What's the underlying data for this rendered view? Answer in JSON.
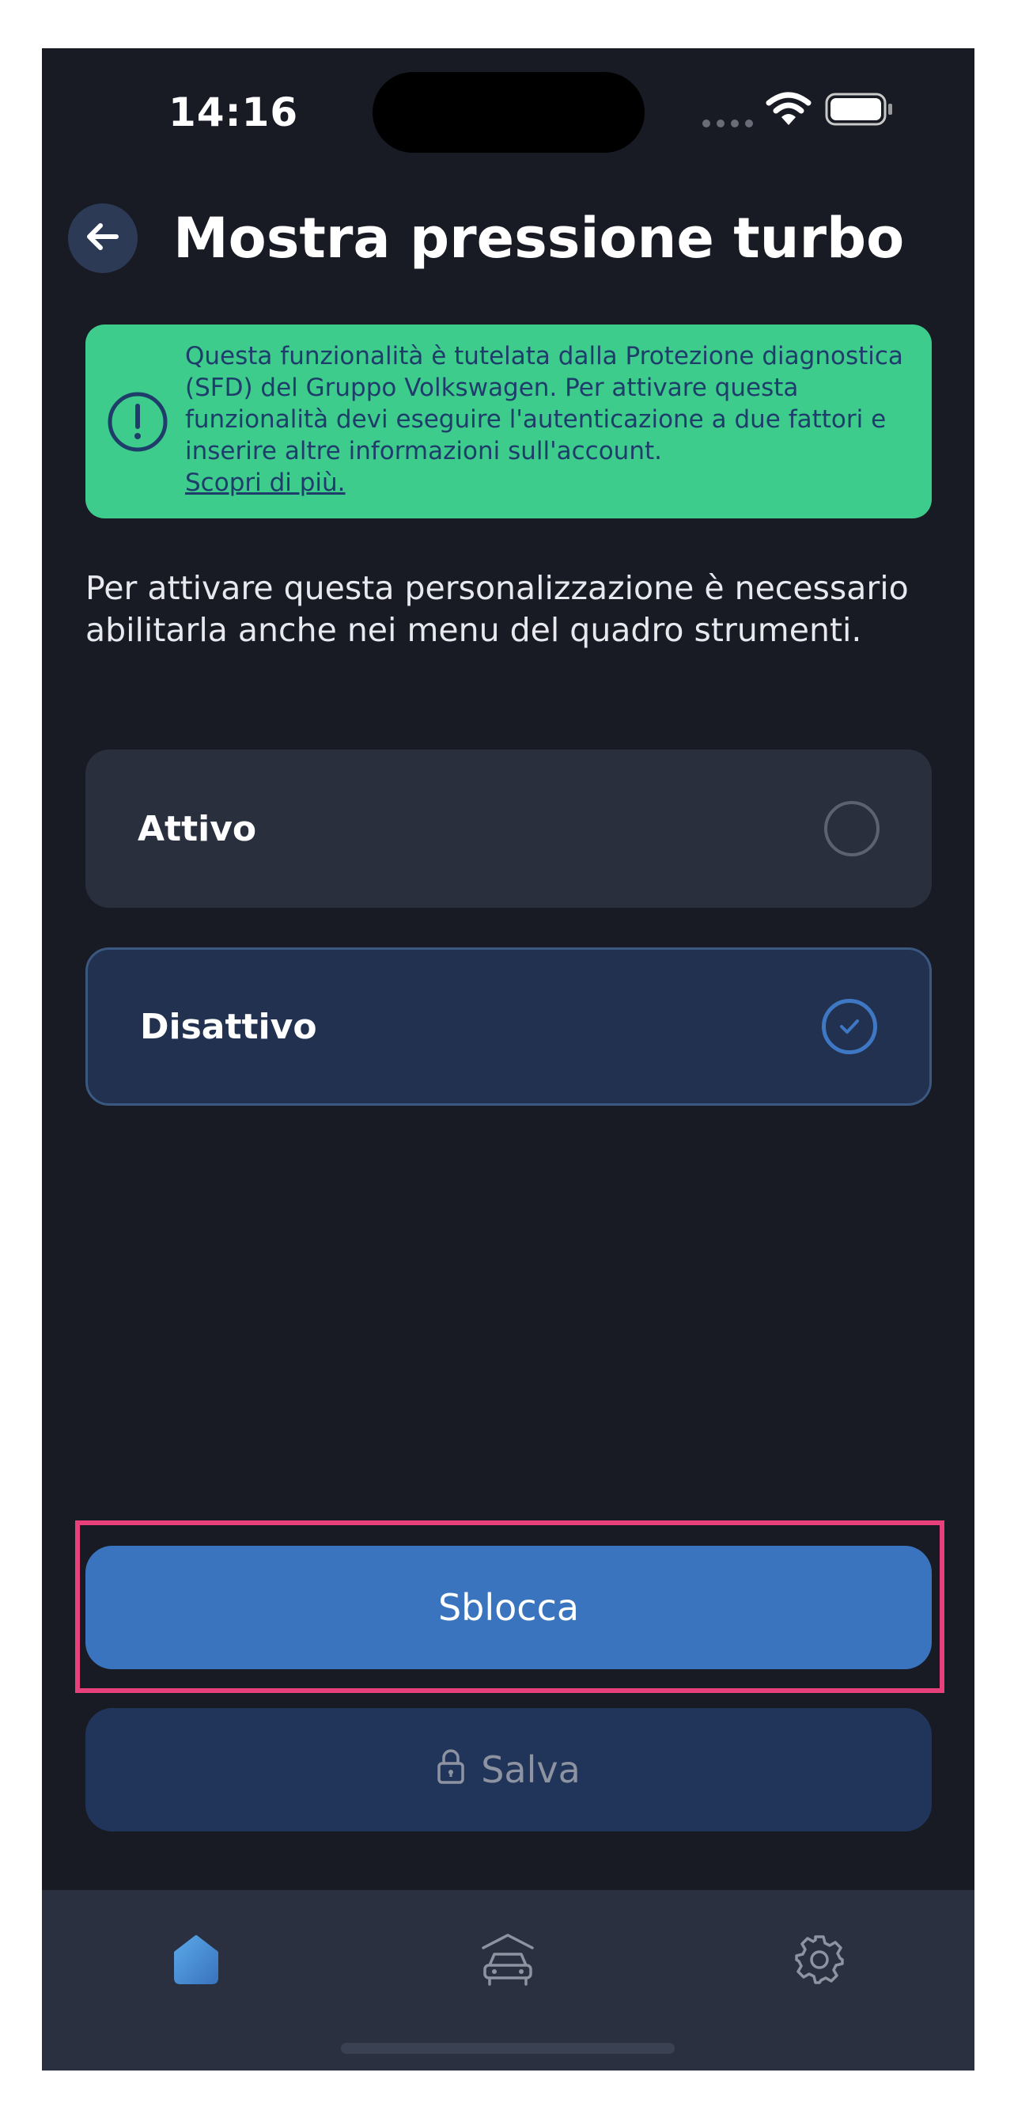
{
  "status_bar": {
    "time": "14:16",
    "wifi_icon": "wifi-icon",
    "battery_icon": "battery-icon"
  },
  "header": {
    "back_icon": "arrow-left-icon",
    "title": "Mostra pressione turbo"
  },
  "banner": {
    "icon": "exclamation-circle-icon",
    "text": "Questa funzionalità è tutelata dalla Protezione diagnostica (SFD) del Gruppo Volkswagen. Per attivare questa funzionalità devi eseguire l'autenticazione a due fattori e inserire altre informazioni sull'account.",
    "link": "Scopri di più."
  },
  "description": "Per attivare questa personalizzazione è necessario abilitarla anche nei menu del quadro strumenti.",
  "options": [
    {
      "label": "Attivo",
      "selected": false
    },
    {
      "label": "Disattivo",
      "selected": true
    }
  ],
  "buttons": {
    "unlock": "Sblocca",
    "save": "Salva",
    "save_icon": "lock-icon"
  },
  "tabbar": {
    "items": [
      {
        "icon": "home-icon",
        "active": true
      },
      {
        "icon": "car-garage-icon",
        "active": false
      },
      {
        "icon": "gear-icon",
        "active": false
      }
    ]
  },
  "colors": {
    "background": "#181a24",
    "banner": "#3ecc8c",
    "accent": "#3a74be",
    "highlight": "#e8407a"
  }
}
